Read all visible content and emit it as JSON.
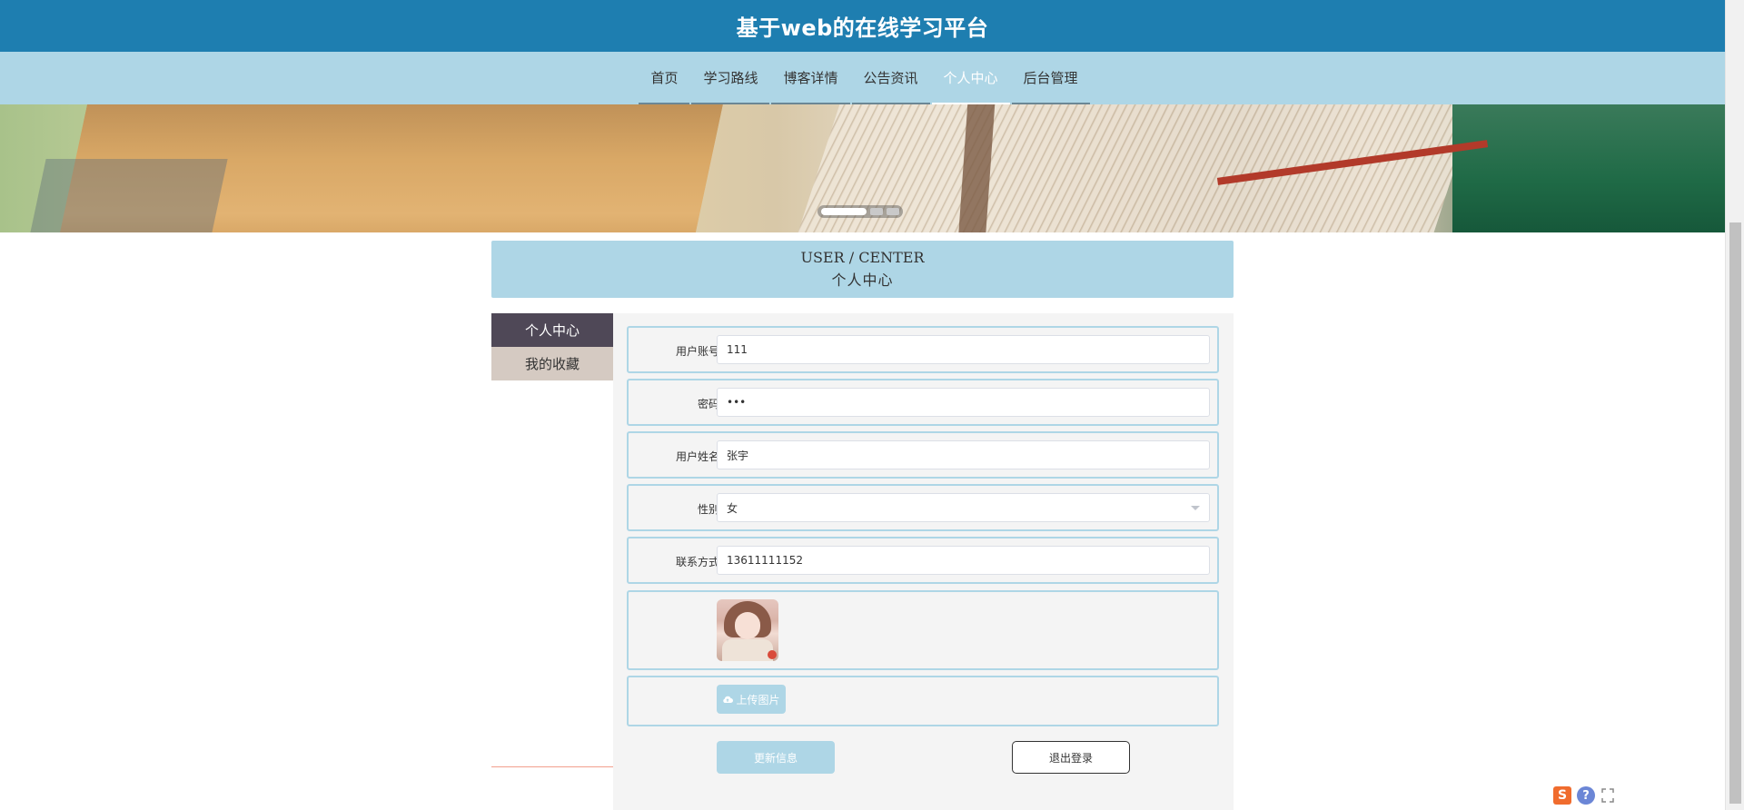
{
  "header": {
    "title": "基于web的在线学习平台"
  },
  "nav": {
    "items": [
      {
        "label": "首页"
      },
      {
        "label": "学习路线"
      },
      {
        "label": "博客详情"
      },
      {
        "label": "公告资讯"
      },
      {
        "label": "个人中心"
      },
      {
        "label": "后台管理"
      }
    ],
    "active_index": 4
  },
  "carousel": {
    "slides": 3,
    "active": 1
  },
  "section": {
    "title_en": "USER / CENTER",
    "title_cn": "个人中心"
  },
  "side_menu": {
    "items": [
      {
        "label": "个人中心"
      },
      {
        "label": "我的收藏"
      }
    ]
  },
  "form": {
    "account": {
      "label": "用户账号",
      "value": "111"
    },
    "password": {
      "label": "密码",
      "value": "•••"
    },
    "name": {
      "label": "用户姓名",
      "value": "张宇"
    },
    "gender": {
      "label": "性别",
      "value": "女"
    },
    "phone": {
      "label": "联系方式",
      "value": "13611111152"
    },
    "upload_label": "上传图片",
    "update_label": "更新信息",
    "logout_label": "退出登录"
  },
  "colors": {
    "header_bg": "#1e7eb0",
    "nav_bg": "#aed6e6",
    "side_active": "#4f4857",
    "side_normal": "#d5cac2"
  },
  "widgets": {
    "s_icon": "sogou-s-icon",
    "help_icon": "help-icon",
    "expand_icon": "expand-icon",
    "s_text": "S",
    "help_text": "?"
  }
}
